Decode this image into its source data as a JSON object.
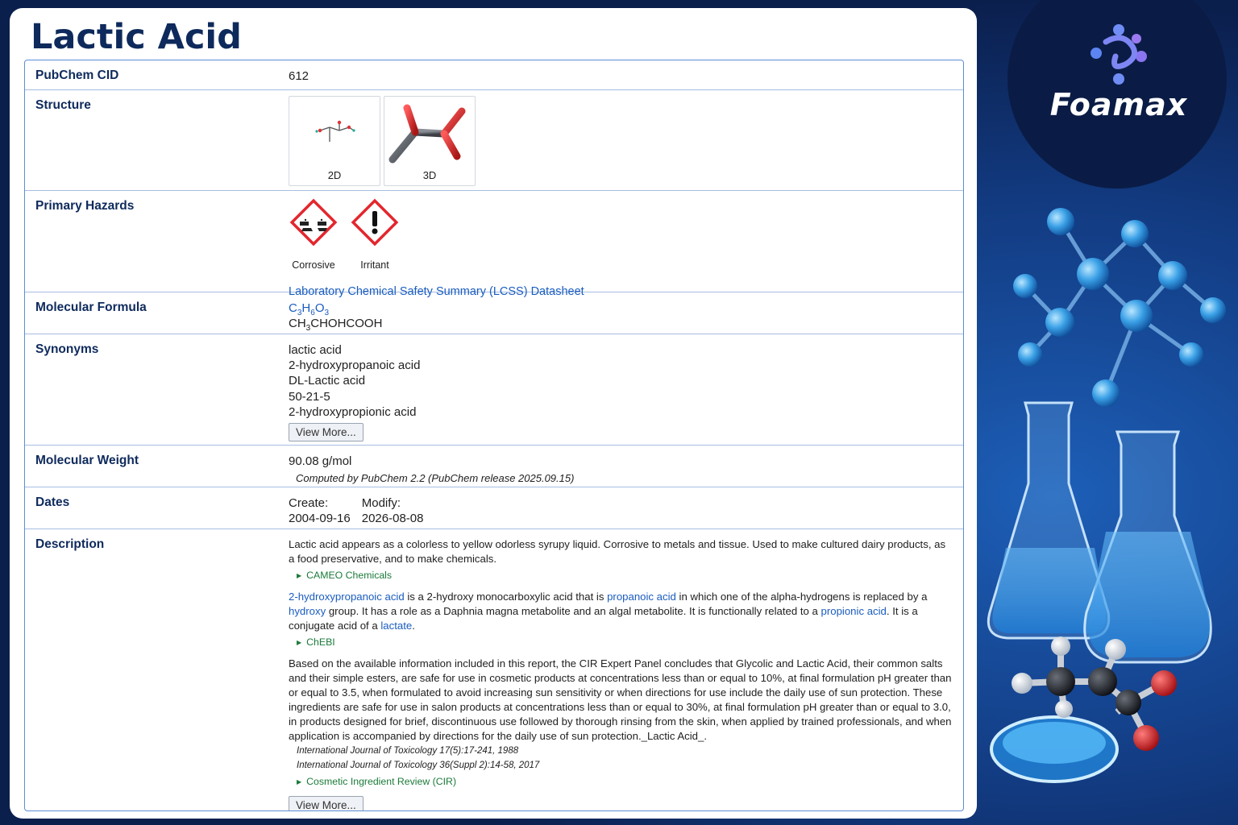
{
  "page": {
    "title": "Lactic Acid"
  },
  "brand": {
    "name": "Foamax"
  },
  "rows": {
    "cid": {
      "label": "PubChem CID",
      "value": "612"
    },
    "structure": {
      "label": "Structure",
      "caption_2d": "2D",
      "caption_3d": "3D"
    },
    "hazards": {
      "label": "Primary Hazards",
      "items": [
        {
          "name": "Corrosive",
          "icon": "corrosive-pictogram-icon"
        },
        {
          "name": "Irritant",
          "icon": "exclamation-pictogram-icon"
        }
      ],
      "lcss_link": "Laboratory Chemical Safety Summary (LCSS) Datasheet"
    },
    "formula": {
      "label": "Molecular Formula",
      "line1": [
        {
          "t": "C",
          "s": "3"
        },
        {
          "t": "H",
          "s": "6"
        },
        {
          "t": "O",
          "s": "3"
        }
      ],
      "line2": [
        {
          "t": "CH",
          "s": "3"
        },
        {
          "t": "CHOHCOOH",
          "s": ""
        }
      ]
    },
    "synonyms": {
      "label": "Synonyms",
      "items": [
        "lactic acid",
        "2-hydroxypropanoic acid",
        "DL-Lactic acid",
        "50-21-5",
        "2-hydroxypropionic acid"
      ],
      "view_more": "View More..."
    },
    "weight": {
      "label": "Molecular Weight",
      "value": "90.08 g/mol",
      "note": "Computed by PubChem 2.2 (PubChem release 2025.09.15)"
    },
    "dates": {
      "label": "Dates",
      "create_label": "Create:",
      "create_value": "2004-09-16",
      "modify_label": "Modify:",
      "modify_value": "2026-08-08"
    },
    "description": {
      "label": "Description",
      "p1": "Lactic acid appears as a colorless to yellow odorless syrupy liquid. Corrosive to metals and tissue. Used to make cultured dairy products, as a food preservative, and to make chemicals.",
      "p1_source": "CAMEO Chemicals",
      "p2": [
        {
          "text": "2-hydroxypropanoic acid",
          "link": true
        },
        {
          "text": " is a 2-hydroxy monocarboxylic acid that is ",
          "link": false
        },
        {
          "text": "propanoic acid",
          "link": true
        },
        {
          "text": " in which one of the alpha-hydrogens is replaced by a ",
          "link": false
        },
        {
          "text": "hydroxy",
          "link": true
        },
        {
          "text": " group. It has a role as a Daphnia magna metabolite and an algal metabolite. It is functionally related to a ",
          "link": false
        },
        {
          "text": "propionic acid",
          "link": true
        },
        {
          "text": ". It is a conjugate acid of a ",
          "link": false
        },
        {
          "text": "lactate",
          "link": true
        },
        {
          "text": ".",
          "link": false
        }
      ],
      "p2_source": "ChEBI",
      "p3": "Based on the available information included in this report, the CIR Expert Panel concludes that Glycolic and Lactic Acid, their common salts and their simple esters, are safe for use in cosmetic products at concentrations less than or equal to 10%, at final formulation pH greater than or equal to 3.5, when formulated to avoid increasing sun sensitivity or when directions for use include the daily use of sun protection. These ingredients are safe for use in salon products at concentrations less than or equal to 30%, at final formulation pH greater than or equal to 3.0, in products designed for brief, discontinuous use followed by thorough rinsing from the skin, when applied by trained professionals, and when application is accompanied by directions for the daily use of sun protection._Lactic Acid_.",
      "refs": [
        "International Journal of Toxicology 17(5):17-241, 1988",
        "International Journal of Toxicology 36(Suppl 2):14-58, 2017"
      ],
      "p3_source": "Cosmetic Ingredient Review (CIR)",
      "view_more": "View More..."
    }
  },
  "colors": {
    "background": "#0b1f4d",
    "title": "#0e2a5c",
    "link": "#1a5cbf",
    "source": "#1b7a3a",
    "hazard_red": "#e3262d"
  }
}
